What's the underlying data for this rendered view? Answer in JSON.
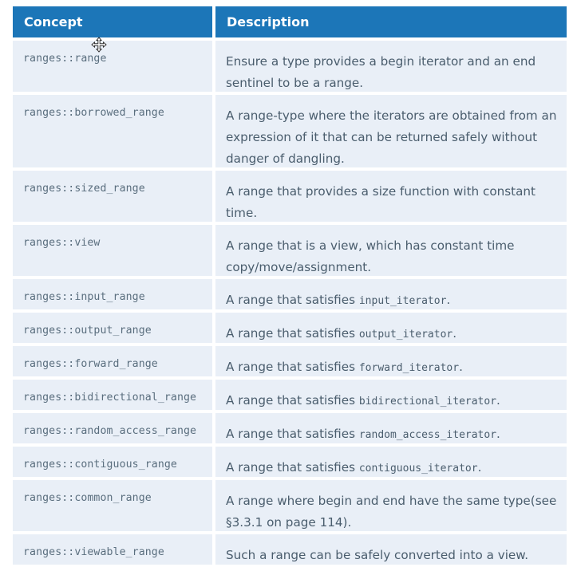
{
  "table": {
    "headers": {
      "concept": "Concept",
      "description": "Description"
    },
    "rows": [
      {
        "concept": "ranges::range",
        "desc_before": "Ensure a type provides a begin iterator and an end sentinel to be a range.",
        "desc_code": "",
        "desc_after": ""
      },
      {
        "concept": "ranges::borrowed_range",
        "desc_before": "A range-type where the iterators are obtained from an expression of it that can be returned safely without danger of dangling.",
        "desc_code": "",
        "desc_after": ""
      },
      {
        "concept": "ranges::sized_range",
        "desc_before": "A range that provides a size function with constant time.",
        "desc_code": "",
        "desc_after": ""
      },
      {
        "concept": "ranges::view",
        "desc_before": "A range that is a view, which has constant time copy/move/assignment.",
        "desc_code": "",
        "desc_after": ""
      },
      {
        "concept": "ranges::input_range",
        "desc_before": "A range that satisfies ",
        "desc_code": "input_iterator",
        "desc_after": "."
      },
      {
        "concept": "ranges::output_range",
        "desc_before": "A range that satisfies ",
        "desc_code": "output_iterator",
        "desc_after": "."
      },
      {
        "concept": "ranges::forward_range",
        "desc_before": "A range that satisfies ",
        "desc_code": "forward_iterator",
        "desc_after": "."
      },
      {
        "concept": "ranges::bidirectional_range",
        "desc_before": "A range that satisfies ",
        "desc_code": "bidirectional_iterator",
        "desc_after": "."
      },
      {
        "concept": "ranges::random_access_range",
        "desc_before": "A range that satisfies ",
        "desc_code": "random_access_iterator",
        "desc_after": "."
      },
      {
        "concept": "ranges::contiguous_range",
        "desc_before": "A range that satisfies ",
        "desc_code": "contiguous_iterator",
        "desc_after": "."
      },
      {
        "concept": "ranges::common_range",
        "desc_before": "A range where begin and end have the same type(see §3.3.1 on page 114).",
        "desc_code": "",
        "desc_after": ""
      },
      {
        "concept": "ranges::viewable_range",
        "desc_before": "Such a range can be safely converted into a view.",
        "desc_code": "",
        "desc_after": ""
      }
    ]
  },
  "cursor": {
    "icon": "move-cursor-icon"
  },
  "colors": {
    "header_bg": "#1c76b8",
    "row_bg": "#e9eff7",
    "text": "#4a5d6d"
  }
}
